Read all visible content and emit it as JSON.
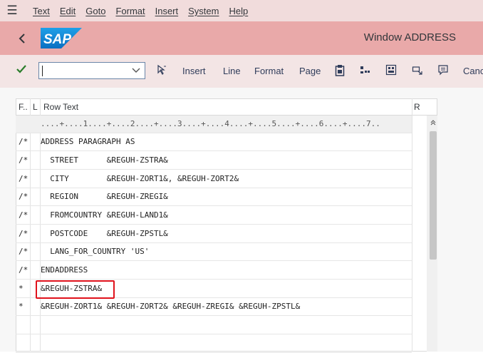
{
  "menubar": {
    "items": [
      "Text",
      "Edit",
      "Goto",
      "Format",
      "Insert",
      "System",
      "Help"
    ]
  },
  "titlebar": {
    "title": "Window ADDRESS",
    "logo_text": "SAP"
  },
  "toolbar": {
    "command_value": "",
    "buttons": [
      "Insert",
      "Line",
      "Format",
      "Page",
      "Canc"
    ]
  },
  "table": {
    "headers": {
      "f": "F..",
      "l": "L",
      "row_text": "Row Text",
      "r": "R"
    },
    "ruler": "....+....1....+....2....+....3....+....4....+....5....+....6....+....7..",
    "rows": [
      {
        "f": "/*",
        "text": "ADDRESS PARAGRAPH AS"
      },
      {
        "f": "/*",
        "text": "  STREET      &REGUH-ZSTRA&"
      },
      {
        "f": "/*",
        "text": "  CITY        &REGUH-ZORT1&, &REGUH-ZORT2&"
      },
      {
        "f": "/*",
        "text": "  REGION      &REGUH-ZREGI&"
      },
      {
        "f": "/*",
        "text": "  FROMCOUNTRY &REGUH-LAND1&"
      },
      {
        "f": "/*",
        "text": "  POSTCODE    &REGUH-ZPSTL&"
      },
      {
        "f": "/*",
        "text": "  LANG_FOR_COUNTRY 'US'"
      },
      {
        "f": "/*",
        "text": "ENDADDRESS"
      },
      {
        "f": "*",
        "text": "&REGUH-ZSTRA&"
      },
      {
        "f": "*",
        "text": "&REGUH-ZORT1& &REGUH-ZORT2& &REGUH-ZREGI& &REGUH-ZPSTL&"
      },
      {
        "f": "",
        "text": ""
      },
      {
        "f": "",
        "text": ""
      }
    ]
  },
  "colors": {
    "menubar_bg": "#f1dcdc",
    "titlebar_bg": "#e9a9a9",
    "toolbar_bg": "#f3e5e5",
    "highlight": "#e0121c",
    "check": "#2b7d2b"
  }
}
